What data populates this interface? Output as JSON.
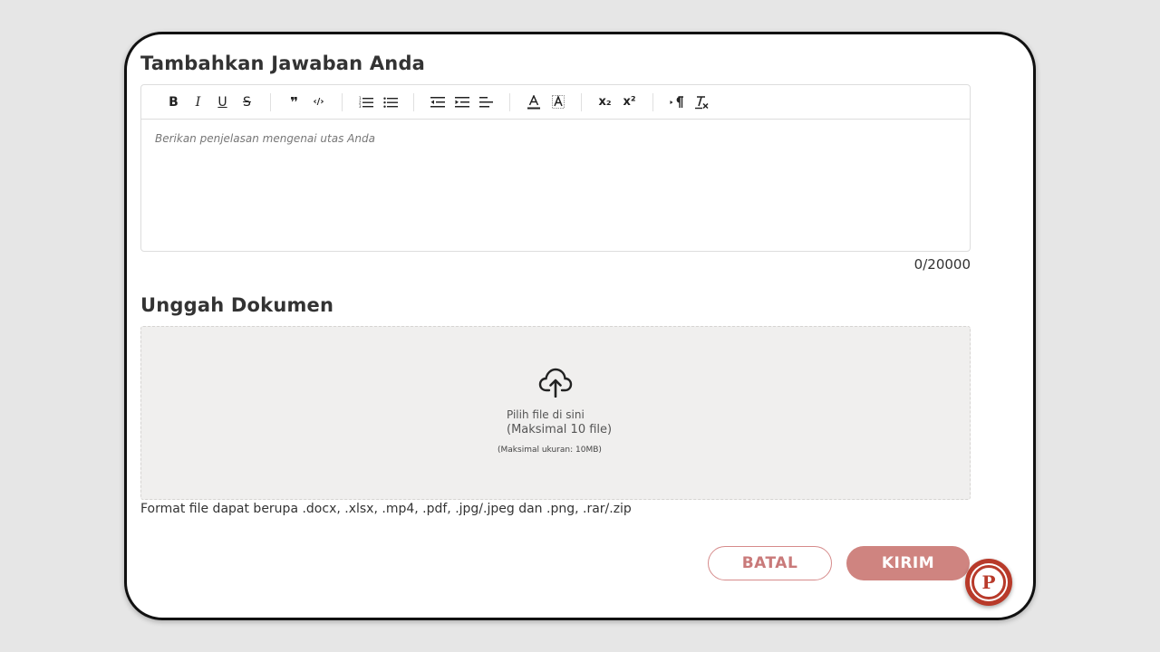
{
  "answer_section": {
    "title": "Tambahkan Jawaban Anda",
    "placeholder": "Berikan penjelasan mengenai utas Anda",
    "counter": "0/20000",
    "toolbar": {
      "bold": "B",
      "italic": "I",
      "underline": "U",
      "strike": "S",
      "blockquote": "❞",
      "code": "‹/›",
      "subscript": "x₂",
      "superscript": "x²"
    }
  },
  "upload_section": {
    "title": "Unggah Dokumen",
    "choose_text": "Pilih file di sini",
    "max_files": "(Maksimal 10 file)",
    "max_size": "(Maksimal ukuran: 10MB)",
    "formats": "Format file dapat berupa .docx, .xlsx, .mp4, .pdf, .jpg/.jpeg dan .png, .rar/.zip"
  },
  "actions": {
    "cancel_label": "BATAL",
    "submit_label": "KIRIM"
  },
  "fab": {
    "letter": "P"
  },
  "colors": {
    "accent": "#cf8480",
    "accent_border": "#d68b8b",
    "fab_red": "#b83a2a",
    "dropzone_bg": "#f0efee"
  }
}
